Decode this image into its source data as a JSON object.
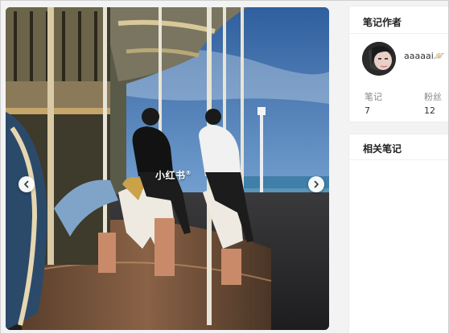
{
  "post": {
    "watermark": "小红书",
    "watermark_reg": "®",
    "image_icon": "carousel-photo",
    "prev_icon": "chevron-left-icon",
    "next_icon": "chevron-right-icon"
  },
  "author": {
    "section_title": "笔记作者",
    "name": "aaaaai🪐",
    "stats": [
      {
        "label": "笔记",
        "value": "7"
      },
      {
        "label": "粉丝",
        "value": "12"
      }
    ]
  },
  "related": {
    "section_title": "相关笔记"
  },
  "colors": {
    "sky": "#3f6fa8",
    "card_bg": "#ffffff",
    "page_bg": "#f3f3f3"
  }
}
